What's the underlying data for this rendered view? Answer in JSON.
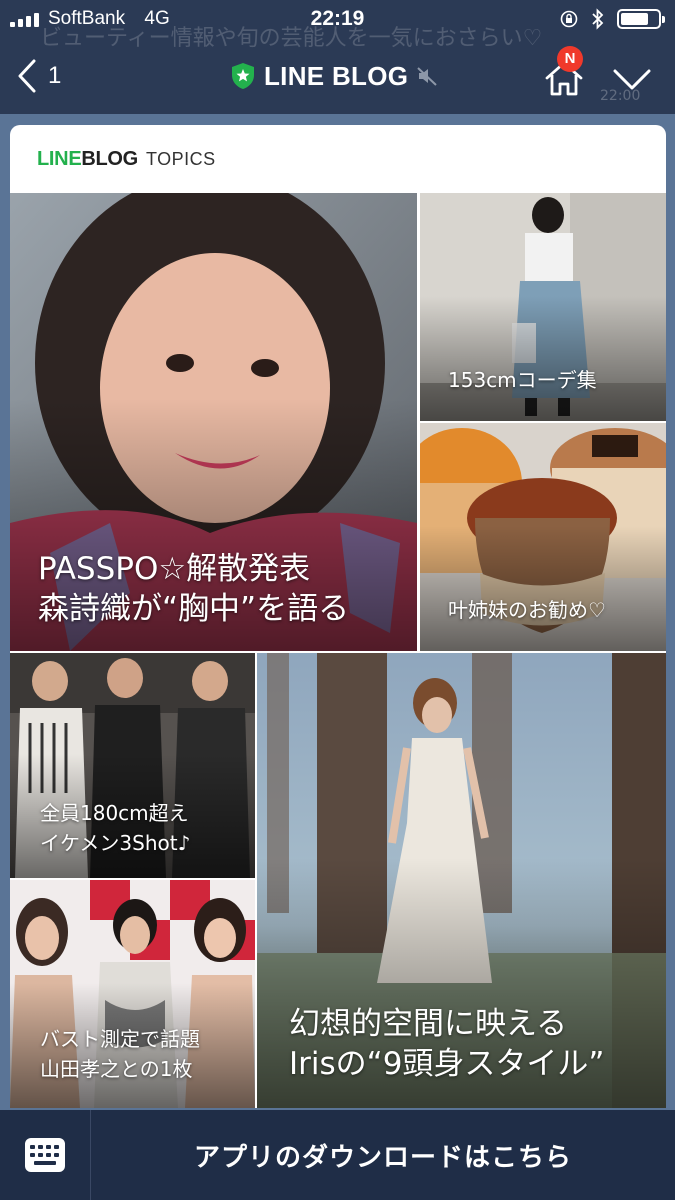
{
  "status_bar": {
    "carrier": "SoftBank",
    "network": "4G",
    "time": "22:19",
    "battery_level": 0.75
  },
  "background_chat": {
    "preview_text": "ビューティー情報や旬の芸能人を一気におさらい♡",
    "time": "22:00"
  },
  "nav": {
    "back_count": "1",
    "title": "LINE BLOG",
    "home_badge": "N"
  },
  "card": {
    "brand_line": "LINE",
    "brand_blog": "BLOG",
    "brand_topics": "TOPICS",
    "tiles": [
      {
        "caption_lines": [
          "PASSPO☆解散発表",
          "森詩織が“胸中”を語る"
        ]
      },
      {
        "caption_lines": [
          "153cmコーデ集"
        ]
      },
      {
        "caption_lines": [
          "叶姉妹のお勧め♡"
        ]
      },
      {
        "caption_lines": [
          "全員180cm超え",
          "イケメン3Shot♪"
        ]
      },
      {
        "caption_lines": [
          "幻想的空間に映える",
          "Irisの“9頭身スタイル”"
        ]
      },
      {
        "caption_lines": [
          "バスト測定で話題",
          "山田孝之との1枚"
        ]
      }
    ]
  },
  "bottom_bar": {
    "download_label": "アプリのダウンロードはこちら"
  },
  "colors": {
    "header_bg": "#2b3a55",
    "bottom_bar_bg": "#1f2d47",
    "line_green": "#23b14d",
    "badge_red": "#f0392b"
  },
  "icons": [
    "signal-icon",
    "lock-rotation-icon",
    "bluetooth-icon",
    "battery-icon",
    "back-chevron-icon",
    "verified-star-icon",
    "mute-icon",
    "home-icon",
    "chevron-down-icon",
    "keyboard-icon"
  ]
}
